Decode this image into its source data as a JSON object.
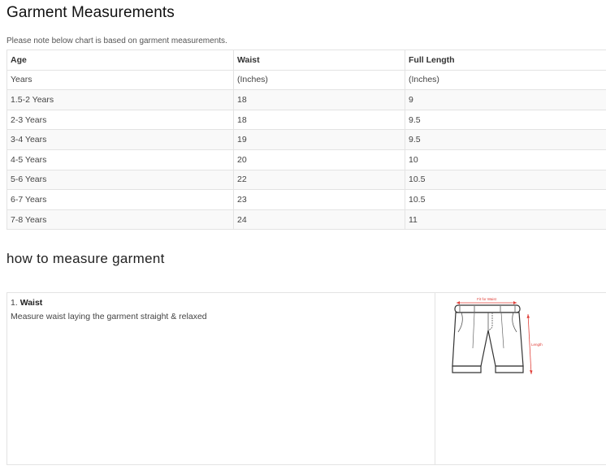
{
  "page": {
    "title": "Garment Measurements",
    "note": "Please note below chart is based on garment measurements."
  },
  "size_table": {
    "headers": [
      "Age",
      "Waist",
      "Full Length"
    ],
    "rows": [
      [
        "Years",
        "(Inches)",
        "(Inches)"
      ],
      [
        "1.5-2 Years",
        "18",
        "9"
      ],
      [
        "2-3 Years",
        "18",
        "9.5"
      ],
      [
        "3-4 Years",
        "19",
        "9.5"
      ],
      [
        "4-5 Years",
        "20",
        "10"
      ],
      [
        "5-6 Years",
        "22",
        "10.5"
      ],
      [
        "6-7 Years",
        "23",
        "10.5"
      ],
      [
        "7-8 Years",
        "24",
        "11"
      ]
    ]
  },
  "howto": {
    "heading": "how to measure garment",
    "step_number": "1.",
    "step_name": "Waist",
    "step_text": "Measure waist laying the garment straight & relaxed",
    "illustration": {
      "icon": "shorts-illustration",
      "waist_label": "Fit for Waist",
      "length_label": "Length",
      "accent_color": "#e0403a"
    }
  }
}
